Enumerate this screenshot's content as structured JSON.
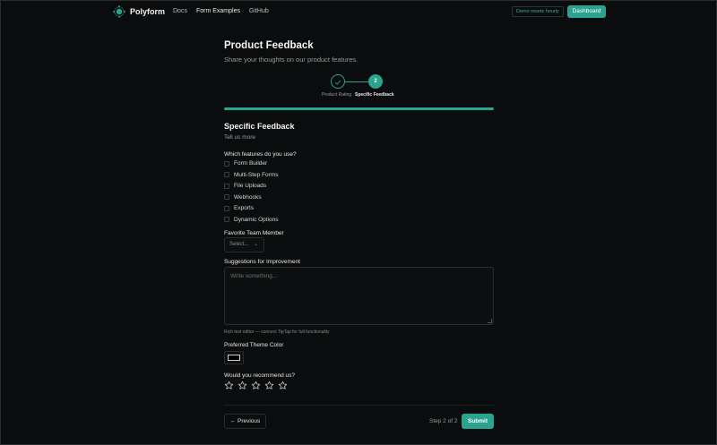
{
  "nav": {
    "brand": "Polyform",
    "links": [
      "Docs",
      "Form Examples",
      "GitHub"
    ],
    "badge": "Demo resets hourly",
    "dashboard": "Dashboard"
  },
  "form": {
    "title": "Product Feedback",
    "subtitle": "Share your thoughts on our product features.",
    "steps": [
      {
        "label": "Product Rating",
        "state": "complete"
      },
      {
        "label": "Specific Feedback",
        "number": "2",
        "state": "current"
      }
    ],
    "progress_percent": 100
  },
  "section": {
    "title": "Specific Feedback",
    "subtitle": "Tell us more",
    "features_label": "Which features do you use?",
    "features": [
      "Form Builder",
      "Multi-Step Forms",
      "File Uploads",
      "Webhooks",
      "Exports",
      "Dynamic Options"
    ],
    "team_label": "Favorite Team Member",
    "team_select": "Select...",
    "suggestions_label": "Suggestions for Improvement",
    "suggestions_placeholder": "Write something...",
    "suggestions_hint": "Rich text editor — connect TipTap for full functionality",
    "color_label": "Preferred Theme Color",
    "color_value": "#000000",
    "recommend_label": "Would you recommend us?",
    "stars_count": 5,
    "stars_selected": 0
  },
  "footer": {
    "previous": "← Previous",
    "step_count": "Step 2 of 2",
    "submit": "Submit"
  },
  "colors": {
    "accent": "#2aa38f",
    "background": "#0b0c0d"
  }
}
